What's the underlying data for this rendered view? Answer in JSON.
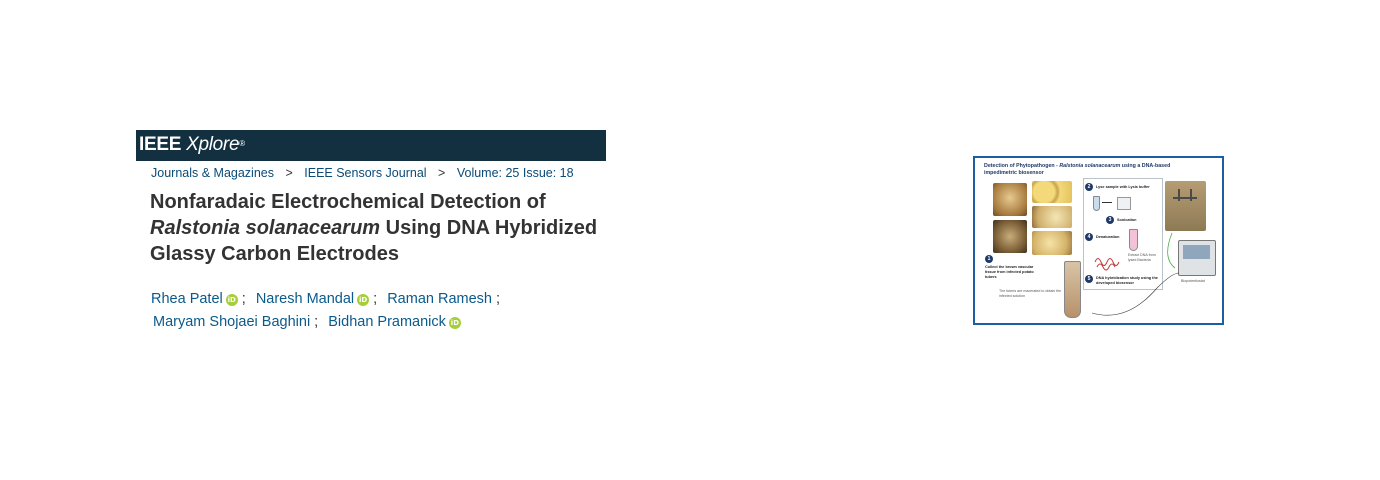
{
  "header": {
    "logo_ieee": "IEEE",
    "logo_xplore": "Xplore",
    "logo_reg": "®"
  },
  "breadcrumb": {
    "items": [
      "Journals & Magazines",
      "IEEE Sensors Journal",
      "Volume: 25 Issue: 18"
    ],
    "separator": ">"
  },
  "article": {
    "title_part1": "Nonfaradaic Electrochemical Detection of",
    "title_species": "Ralstonia solanacearum",
    "title_part2": "Using DNA Hybridized Glassy Carbon Electrodes"
  },
  "authors": [
    {
      "name": "Rhea Patel",
      "orcid": true
    },
    {
      "name": "Naresh Mandal",
      "orcid": true
    },
    {
      "name": "Raman Ramesh",
      "orcid": false
    },
    {
      "name": "Maryam Shojaei Baghini",
      "orcid": false
    },
    {
      "name": "Bidhan Pramanick",
      "orcid": true
    }
  ],
  "author_separator": ";",
  "orcid_label": "iD",
  "graphical_abstract": {
    "title_prefix": "Detection of Phytopathogen - ",
    "title_species": "Ralstonia solanacearum",
    "title_suffix": " using a DNA-based impedimetric biosensor",
    "steps": [
      {
        "num": "1",
        "text": "Collect the brown vascular tissue from infected potato tubers"
      },
      {
        "num": "2",
        "text": "Lyse sample with Lysis buffer"
      },
      {
        "num": "3",
        "text": "Sonication"
      },
      {
        "num": "4",
        "text": "Denaturation"
      },
      {
        "num": "5",
        "text": "DNA hybridization study using the developed biosensor"
      }
    ],
    "note_tubers": "The tubers are macerated to obtain the infected solution",
    "note_dna": "Extract DNA from lysed Bacteria",
    "label_potentiostat": "Biopotentiostat"
  },
  "colors": {
    "header_bg": "#12303f",
    "link": "#0a5a8c",
    "orcid": "#a6ce39",
    "ga_border": "#1b5fa3"
  }
}
